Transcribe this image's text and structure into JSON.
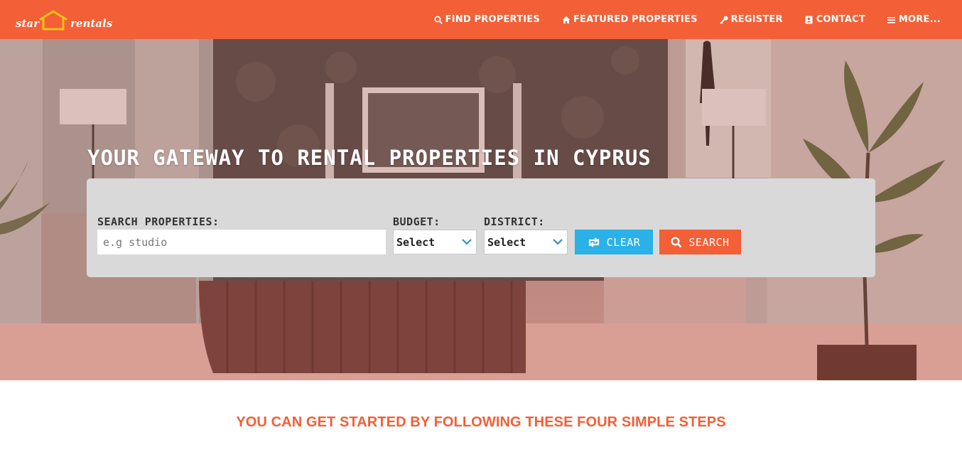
{
  "brand": {
    "logo_left": "star",
    "logo_right": "rentals"
  },
  "nav": {
    "find_properties": "FIND PROPERTIES",
    "featured_properties": "FEATURED PROPERTIES",
    "register": "REGISTER",
    "contact": "CONTACT",
    "more": "MORE..."
  },
  "hero": {
    "title": "YOUR GATEWAY TO RENTAL PROPERTIES IN CYPRUS"
  },
  "search": {
    "label": "SEARCH PROPERTIES:",
    "placeholder": "e.g studio",
    "budget_label": "BUDGET:",
    "budget_value": "Select",
    "district_label": "DISTRICT:",
    "district_value": "Select",
    "clear_label": "CLEAR",
    "search_label": "SEARCH"
  },
  "steps": {
    "heading": "YOU CAN GET STARTED BY FOLLOWING THESE FOUR SIMPLE STEPS"
  },
  "colors": {
    "accent": "#f35f36",
    "clear_button": "#29b1e8",
    "panel": "#d9d9d9"
  }
}
